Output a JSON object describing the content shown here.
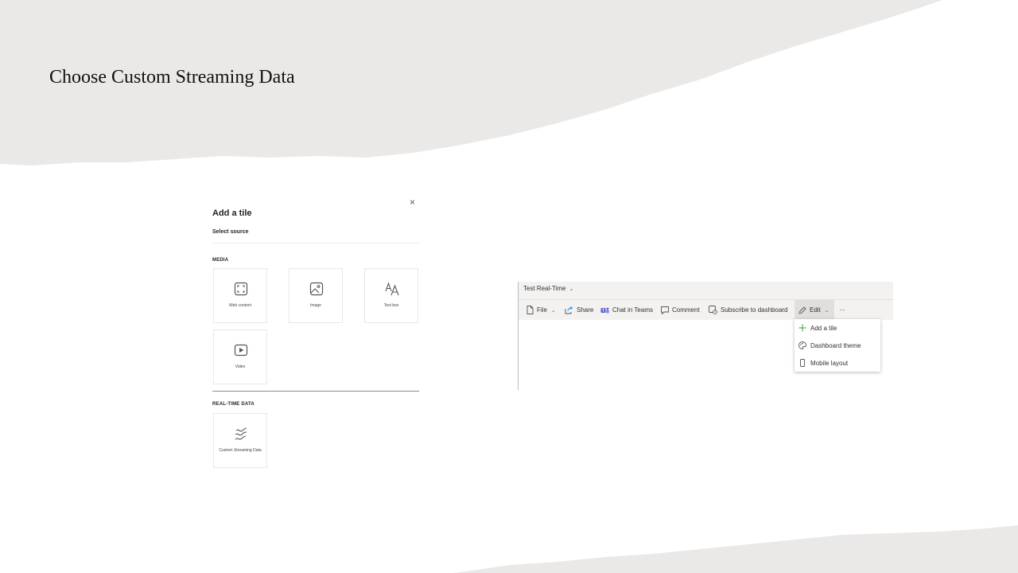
{
  "slide": {
    "title": "Choose Custom Streaming Data"
  },
  "add_tile_panel": {
    "close_label": "×",
    "title": "Add a tile",
    "subtitle": "Select source",
    "sections": {
      "media": {
        "label": "MEDIA",
        "tiles": [
          {
            "label": "Web content",
            "icon": "web-content-icon"
          },
          {
            "label": "Image",
            "icon": "image-icon"
          },
          {
            "label": "Text box",
            "icon": "text-box-icon"
          },
          {
            "label": "Video",
            "icon": "video-icon"
          }
        ]
      },
      "realtime": {
        "label": "REAL-TIME DATA",
        "tiles": [
          {
            "label": "Custom Streaming Data",
            "icon": "streaming-data-icon"
          }
        ]
      }
    }
  },
  "dashboard": {
    "name": "Test Real-Time",
    "toolbar": {
      "file": "File",
      "share": "Share",
      "chat_in_teams": "Chat in Teams",
      "comment": "Comment",
      "subscribe": "Subscribe to dashboard",
      "edit": "Edit",
      "more": "···"
    },
    "edit_menu": {
      "items": [
        {
          "label": "Add a tile",
          "icon": "plus-icon"
        },
        {
          "label": "Dashboard theme",
          "icon": "palette-icon"
        },
        {
          "label": "Mobile layout",
          "icon": "phone-icon"
        }
      ]
    },
    "accent_color": "#2b88d8",
    "plus_color": "#3a9d4a"
  }
}
